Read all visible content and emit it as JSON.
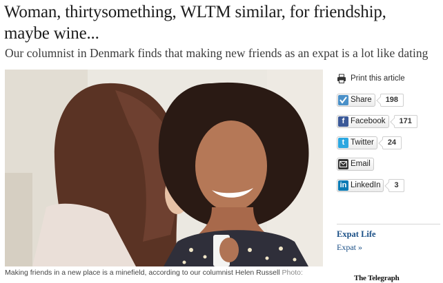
{
  "article": {
    "headline_line1": "Woman, thirtysomething, WLTM similar, for friendship,",
    "headline_line2": "maybe wine...",
    "standfirst": "Our columnist in Denmark finds that making new friends as an expat is a lot like dating",
    "caption": "Making friends in a new place is a minefield, according to our columnist Helen Russell",
    "credit": "Photo:"
  },
  "sidebar": {
    "print_label": "Print this article",
    "share": [
      {
        "label": "Share",
        "count": "198",
        "icon": "share-icon",
        "color": "#4a90c8"
      },
      {
        "label": "Facebook",
        "count": "171",
        "icon": "facebook-icon",
        "color": "#3b5998"
      },
      {
        "label": "Twitter",
        "count": "24",
        "icon": "twitter-icon",
        "color": "#2ca7e0"
      },
      {
        "label": "Email",
        "count": "",
        "icon": "email-icon",
        "color": "#333333"
      },
      {
        "label": "LinkedIn",
        "count": "3",
        "icon": "linkedin-icon",
        "color": "#0a7bb5"
      }
    ],
    "section_title": "Expat Life",
    "section_link": "Expat »"
  },
  "brand": {
    "logo_text": "The Telegraph",
    "link_color": "#1a4f86"
  }
}
